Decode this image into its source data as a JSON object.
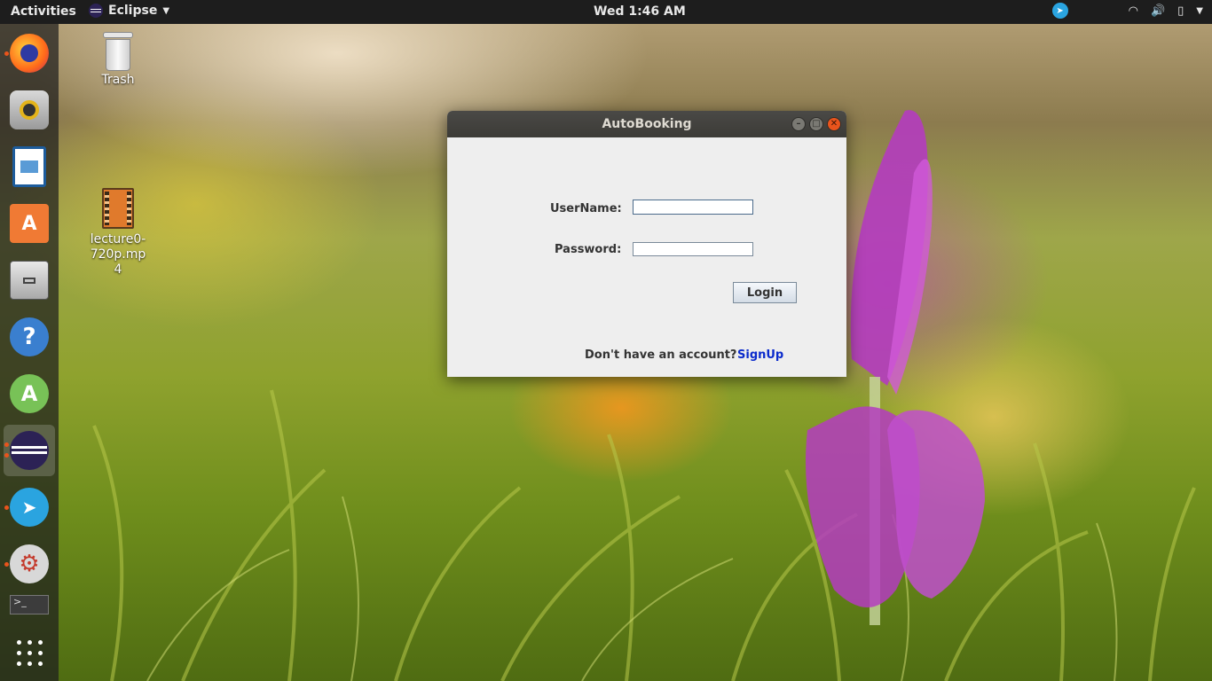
{
  "topbar": {
    "activities": "Activities",
    "app_name": "Eclipse",
    "clock": "Wed  1:46 AM"
  },
  "dock": {
    "items": [
      {
        "name": "firefox",
        "running": true
      },
      {
        "name": "rhythmbox",
        "running": false
      },
      {
        "name": "libreoffice-writer",
        "running": false
      },
      {
        "name": "ubuntu-software",
        "running": false
      },
      {
        "name": "files",
        "running": false
      },
      {
        "name": "help",
        "running": false
      },
      {
        "name": "android-studio",
        "running": false
      },
      {
        "name": "eclipse",
        "running": true,
        "active": true
      },
      {
        "name": "telegram",
        "running": true
      },
      {
        "name": "system-tools",
        "running": true
      },
      {
        "name": "terminal",
        "running": false
      }
    ]
  },
  "desktop": {
    "trash_label": "Trash",
    "file_label": "lecture0-720p.mp4"
  },
  "window": {
    "title": "AutoBooking",
    "username_label": "UserName:",
    "username_value": "",
    "password_label": "Password:",
    "password_value": "",
    "login_label": "Login",
    "signup_prompt": "Don't have an account?",
    "signup_link": "SignUp"
  }
}
